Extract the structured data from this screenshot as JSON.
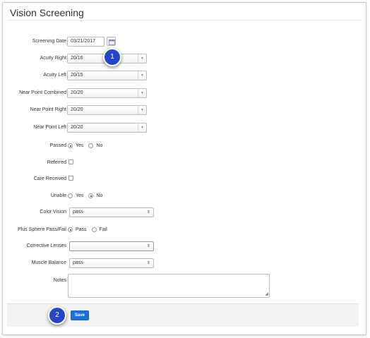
{
  "panel": {
    "title": "Vision Screening"
  },
  "form": {
    "screening_date": {
      "label": "Screening Date",
      "value": "03/21/2017"
    },
    "acuity_right": {
      "label": "Acuity Right",
      "value": "20/16"
    },
    "acuity_left": {
      "label": "Acuity Left",
      "value": "20/15"
    },
    "near_point_combined": {
      "label": "Near Point Combined",
      "value": "20/20"
    },
    "near_point_right": {
      "label": "Near Point Right",
      "value": "20/20"
    },
    "near_point_left": {
      "label": "Near Point Left",
      "value": "20/20"
    },
    "passed": {
      "label": "Passed",
      "options": [
        "Yes",
        "No"
      ],
      "selected": "Yes"
    },
    "referred": {
      "label": "Referred",
      "checked": false
    },
    "care_received": {
      "label": "Care Received",
      "checked": false
    },
    "unable": {
      "label": "Unable",
      "options": [
        "Yes",
        "No"
      ],
      "selected": "No"
    },
    "color_vision": {
      "label": "Color Vision",
      "value": "pass"
    },
    "plus_sphere": {
      "label": "Plus Sphere Pass/Fail",
      "options": [
        "Pass",
        "Fail"
      ],
      "selected": "Pass"
    },
    "corrective_lenses": {
      "label": "Corrective Lenses",
      "value": ""
    },
    "muscle_balance": {
      "label": "Muscle Balance",
      "value": "pass"
    },
    "notes": {
      "label": "Notes",
      "value": ""
    }
  },
  "footer": {
    "save_label": "Save"
  },
  "callouts": [
    "1",
    "2"
  ],
  "icons": {
    "calendar": "calendar-icon",
    "dropdown": "chevron-down-icon",
    "updown": "updown-arrows-icon",
    "resize": "resize-grip-icon"
  },
  "colors": {
    "save_button": "#1f6fd6",
    "callout": "#2545c8"
  }
}
